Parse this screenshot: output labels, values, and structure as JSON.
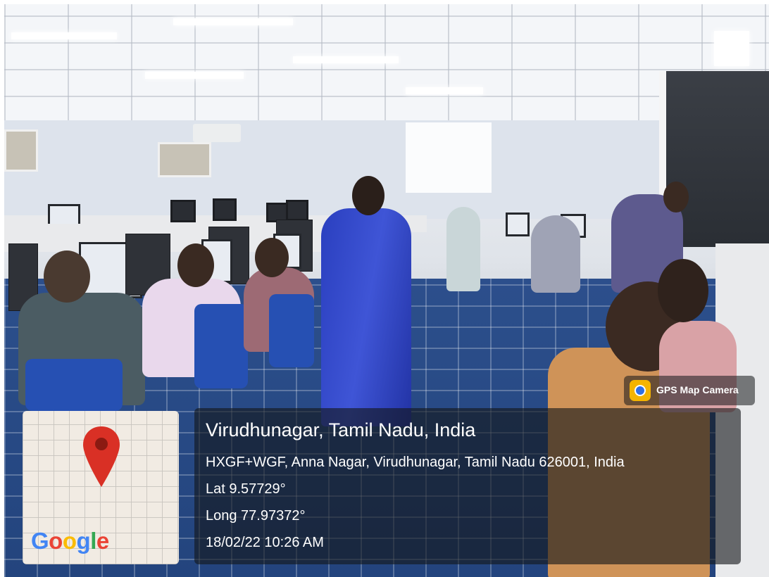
{
  "overlay": {
    "app_badge": "GPS Map Camera",
    "app_icon": "gps-map-camera-icon",
    "location_title": "Virudhunagar, Tamil Nadu, India",
    "address": "HXGF+WGF, Anna Nagar, Virudhunagar, Tamil Nadu 626001, India",
    "latitude": "Lat 9.57729°",
    "longitude": "Long 77.97372°",
    "datetime": "18/02/22 10:26 AM",
    "map_provider": "Google",
    "map_pin_icon": "map-pin-icon",
    "colors": {
      "panel_bg": "#16181c",
      "pin_red": "#d93025",
      "google_blue": "#4285f4",
      "google_red": "#ea4335",
      "google_yellow": "#fbbc05",
      "google_green": "#34a853"
    }
  }
}
